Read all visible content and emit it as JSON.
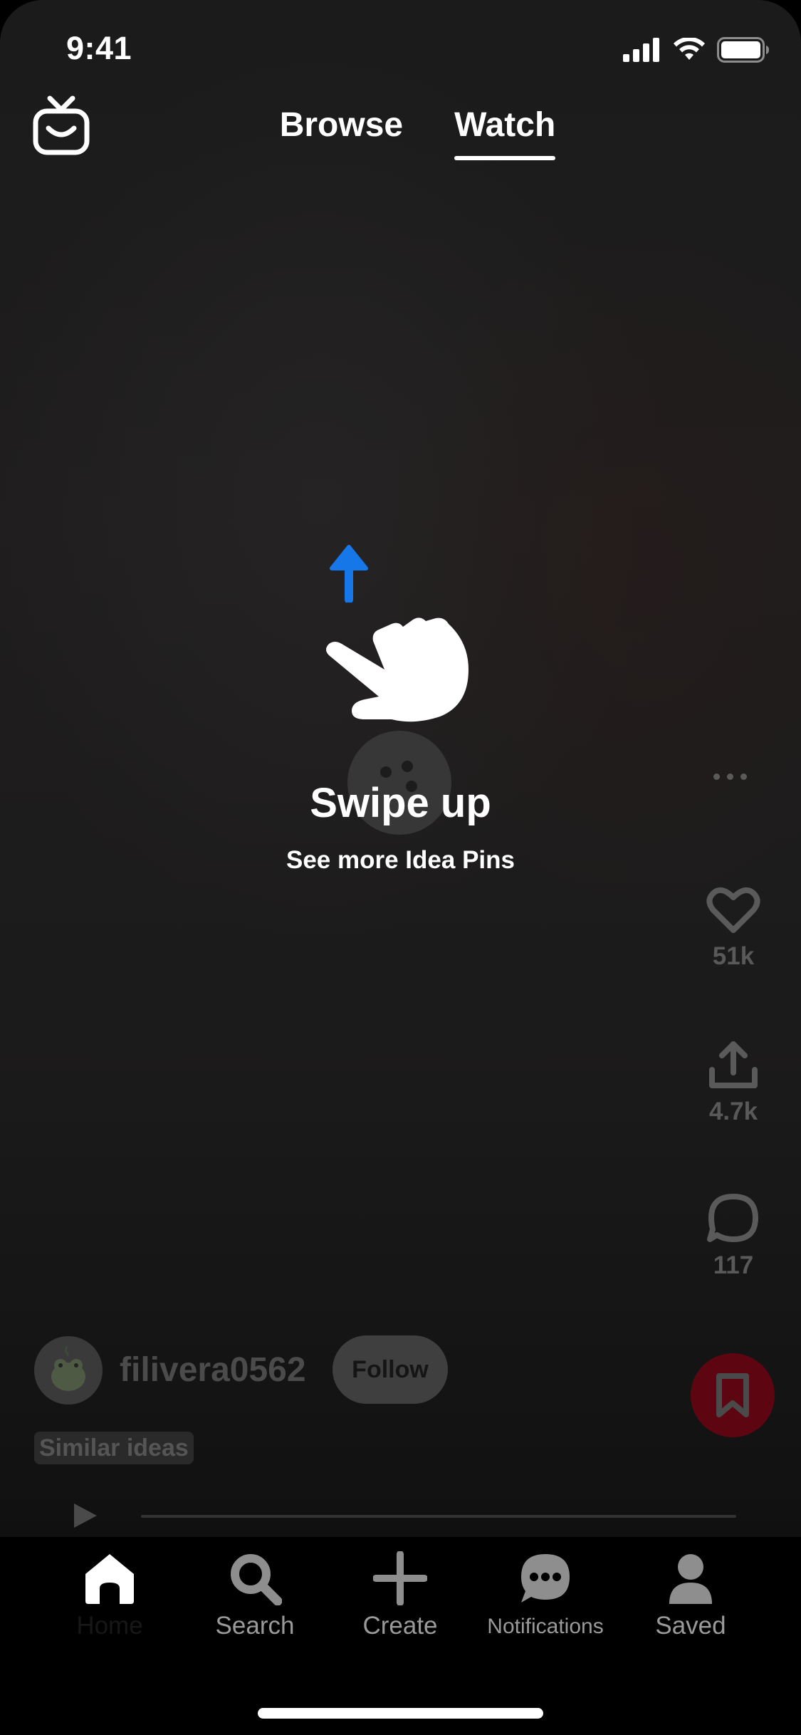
{
  "status_bar": {
    "time": "9:41"
  },
  "header": {
    "icon": "tv-icon",
    "tabs": [
      {
        "label": "Browse",
        "active": false
      },
      {
        "label": "Watch",
        "active": true
      }
    ]
  },
  "tutorial": {
    "title": "Swipe up",
    "subtitle": "See more Idea Pins",
    "arrow_color": "#1677e8",
    "icons": [
      "arrow-up-icon",
      "pointing-hand-icon"
    ]
  },
  "actions": {
    "more_icon": "more-dots-icon",
    "like": {
      "icon": "heart-icon",
      "count": "51k"
    },
    "share": {
      "icon": "share-icon",
      "count": "4.7k"
    },
    "comment": {
      "icon": "comment-icon",
      "count": "117"
    },
    "save_icon": "bookmark-icon",
    "save_color": "#5d0611"
  },
  "creator": {
    "username": "filivera0562",
    "follow_label": "Follow",
    "similar_label": "Similar ideas"
  },
  "player": {
    "play_icon": "play-icon"
  },
  "nav": {
    "items": [
      {
        "label": "Home",
        "icon": "home-icon",
        "active": true
      },
      {
        "label": "Search",
        "icon": "search-icon"
      },
      {
        "label": "Create",
        "icon": "plus-icon"
      },
      {
        "label": "Notifications",
        "icon": "chat-bubble-icon"
      },
      {
        "label": "Saved",
        "icon": "person-icon"
      }
    ]
  }
}
